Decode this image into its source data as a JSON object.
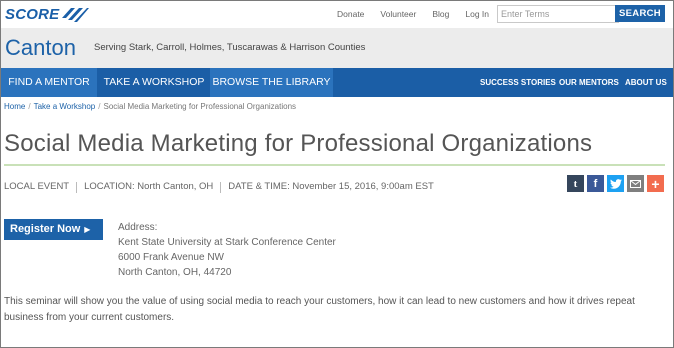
{
  "brand": {
    "logo_text": "SCORE",
    "logo_icon": "score-wings-logo"
  },
  "utility_links": [
    "Donate",
    "Volunteer",
    "Blog",
    "Log In"
  ],
  "search": {
    "placeholder": "Enter Terms",
    "button_label": "SEARCH"
  },
  "chapter": {
    "name": "Canton",
    "subtitle": "Serving Stark, Carroll, Holmes, Tuscarawas & Harrison Counties"
  },
  "nav": {
    "primary": [
      "FIND A MENTOR",
      "TAKE A WORKSHOP",
      "BROWSE THE LIBRARY"
    ],
    "secondary": [
      "SUCCESS STORIES",
      "OUR MENTORS",
      "ABOUT US"
    ]
  },
  "breadcrumb": {
    "home": "Home",
    "section": "Take a Workshop",
    "current": "Social Media Marketing for Professional Organizations"
  },
  "event": {
    "title": "Social Media Marketing for Professional Organizations",
    "type": "LOCAL EVENT",
    "location": "LOCATION: North Canton, OH",
    "datetime": "DATE & TIME: November 15, 2016, 9:00am EST"
  },
  "share_icons": [
    {
      "name": "tumblr-icon",
      "glyph": "t",
      "color": "#35465c"
    },
    {
      "name": "facebook-icon",
      "glyph": "f",
      "color": "#3b5998"
    },
    {
      "name": "twitter-icon",
      "glyph": "t",
      "color": "#1da1f2"
    },
    {
      "name": "email-icon",
      "glyph": "✉",
      "color": "#7f7f7f"
    },
    {
      "name": "plus-share-icon",
      "glyph": "+",
      "color": "#f26c4f"
    }
  ],
  "register": {
    "label": "Register Now"
  },
  "address": {
    "label": "Address:",
    "line1": "Kent State University at Stark Conference Center",
    "line2": "6000 Frank Avenue NW",
    "line3": "North Canton, OH, 44720"
  },
  "description": "This seminar will show you the value of using social media to reach your customers, how it can lead to new customers and how it drives repeat business from your current customers."
}
